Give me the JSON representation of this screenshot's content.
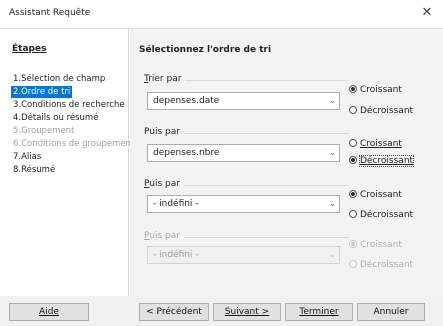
{
  "window": {
    "title": "Assistant Requête"
  },
  "steps": {
    "title": "Étapes",
    "items": [
      {
        "label": "1.Sélection de champ"
      },
      {
        "label": "2.Ordre de tri"
      },
      {
        "label": "3.Conditions de recherche"
      },
      {
        "label": "4.Détails ou résumé"
      },
      {
        "label": "5.Groupement"
      },
      {
        "label": "6.Conditions de groupement"
      },
      {
        "label": "7.Alias"
      },
      {
        "label": "8.Résumé"
      }
    ]
  },
  "content": {
    "title": "Sélectionnez l'ordre de tri",
    "groups": [
      {
        "label_first": "T",
        "label_rest": "rier par",
        "field": "depenses.date",
        "asc": "Croissant",
        "desc": "Décroissant",
        "selected": "asc"
      },
      {
        "label_first": "",
        "label_rest": "Puis par",
        "field": "depenses.nbre",
        "asc": "Croissant",
        "desc": "Décroissant",
        "selected": "desc"
      },
      {
        "label_first": "P",
        "label_rest": "uis par",
        "field": "- indéfini -",
        "asc": "Croissant",
        "desc": "Décroissant",
        "selected": "asc"
      },
      {
        "label_first": "P",
        "label_rest": "uis par",
        "field": "- indéfini -",
        "asc": "Croissant",
        "desc": "Décroissant",
        "selected": "asc"
      }
    ]
  },
  "footer": {
    "help": "Aide",
    "prev": "< Précédent",
    "next": "Suivant >",
    "finish": "Terminer",
    "cancel": "Annuler"
  }
}
